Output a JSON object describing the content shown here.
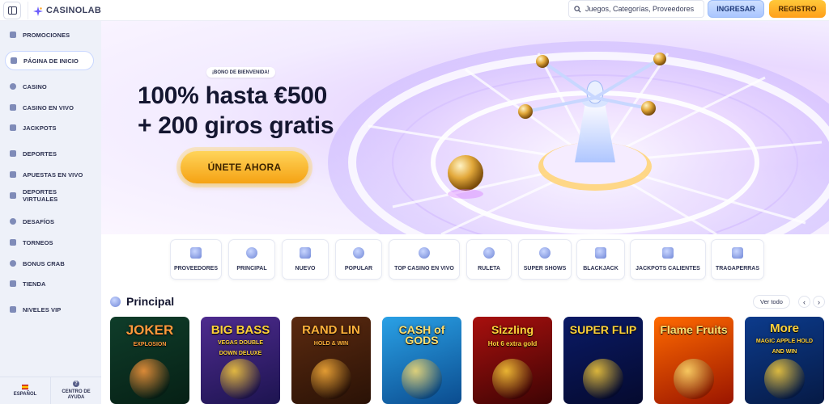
{
  "header": {
    "logo_text": "CASINOLAB",
    "search_placeholder": "Juegos, Categorías, Proveedores",
    "login_label": "INGRESAR",
    "register_label": "REGISTRO"
  },
  "sidebar": {
    "items": [
      {
        "label": "PROMOCIONES",
        "icon": "promotions-icon"
      },
      {
        "label": "PÁGINA DE INICIO",
        "icon": "home-icon",
        "active": true
      },
      {
        "label": "CASINO",
        "icon": "casino-icon"
      },
      {
        "label": "CASINO EN VIVO",
        "icon": "live-casino-icon"
      },
      {
        "label": "JACKPOTS",
        "icon": "jackpots-icon"
      },
      {
        "label": "DEPORTES",
        "icon": "sports-icon"
      },
      {
        "label": "APUESTAS EN VIVO",
        "icon": "live-bets-icon"
      },
      {
        "label_line1": "DEPORTES",
        "label_line2": "VIRTUALES",
        "icon": "virtual-sports-icon"
      },
      {
        "label": "DESAFÍOS",
        "icon": "challenges-icon"
      },
      {
        "label": "TORNEOS",
        "icon": "trophy-icon"
      },
      {
        "label": "BONUS CRAB",
        "icon": "crab-icon"
      },
      {
        "label": "TIENDA",
        "icon": "shop-icon"
      },
      {
        "label": "NIVELES VIP",
        "icon": "vip-icon"
      }
    ],
    "language_label": "ESPAÑOL",
    "help_label_line1": "CENTRO DE",
    "help_label_line2": "AYUDA"
  },
  "hero": {
    "badge": "¡BONO DE BIENVENIDA!",
    "title_line1": "100% hasta €500",
    "title_line2": "+ 200 giros gratis",
    "cta_label": "ÚNETE AHORA"
  },
  "categories": [
    {
      "label": "PROVEEDORES",
      "icon": "filter-icon"
    },
    {
      "label": "PRINCIPAL",
      "icon": "star-burst-icon"
    },
    {
      "label": "NUEVO",
      "icon": "new-icon"
    },
    {
      "label": "POPULAR",
      "icon": "star-icon"
    },
    {
      "label": "TOP CASINO EN VIVO",
      "icon": "live-star-icon"
    },
    {
      "label": "RULETA",
      "icon": "roulette-icon"
    },
    {
      "label": "SUPER SHOWS",
      "icon": "super-shows-icon"
    },
    {
      "label": "BLACKJACK",
      "icon": "cards-icon"
    },
    {
      "label": "JACKPOTS CALIENTES",
      "icon": "hot-jackpot-icon"
    },
    {
      "label": "TRAGAPERRAS",
      "icon": "slot-machine-icon"
    }
  ],
  "section": {
    "title": "Principal",
    "see_all": "Ver todo"
  },
  "games": [
    {
      "title": "JOKER",
      "sub": "EXPLOSION",
      "bg1": "#0f3d2a",
      "bg2": "#062015",
      "color": "#ff9a3c"
    },
    {
      "title": "BIG BASS",
      "sub": "VEGAS DOUBLE DOWN DELUXE",
      "bg1": "#4e2b8f",
      "bg2": "#1d1450",
      "color": "#ffd23a"
    },
    {
      "title": "RAND LIN",
      "sub": "HOLD & WIN",
      "bg1": "#5b2a10",
      "bg2": "#2a1206",
      "color": "#ffb23a"
    },
    {
      "title": "CASH of GODS",
      "sub": "",
      "bg1": "#2aa1e6",
      "bg2": "#0b4c8f",
      "color": "#ffe070"
    },
    {
      "title": "Sizzling",
      "sub": "Hot 6 extra gold",
      "bg1": "#a8100e",
      "bg2": "#3e0404",
      "color": "#ffd23a"
    },
    {
      "title": "SUPER FLIP",
      "sub": "",
      "bg1": "#0a1a66",
      "bg2": "#050a2e",
      "color": "#ffd23a"
    },
    {
      "title": "Flame Fruits",
      "sub": "",
      "bg1": "#ff6a00",
      "bg2": "#9a1500",
      "color": "#ffe070"
    },
    {
      "title": "More",
      "sub": "MAGIC APPLE HOLD AND WIN",
      "bg1": "#0c3b8c",
      "bg2": "#061a45",
      "color": "#ffd23a"
    }
  ]
}
